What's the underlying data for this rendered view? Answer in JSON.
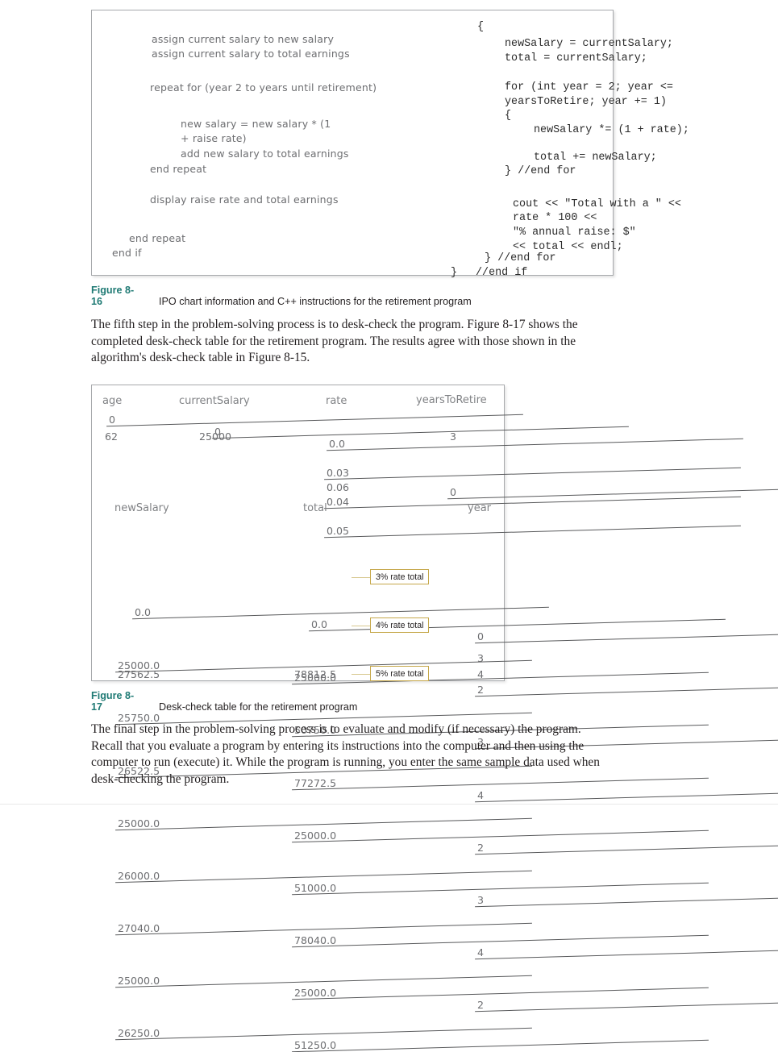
{
  "figure_8_16": {
    "caption_label": "Figure 8-16",
    "caption_text": "IPO chart information and C++ instructions for the retirement program",
    "pseudocode": [
      "assign current salary to new salary",
      "assign current salary to total earnings",
      "repeat for (year 2 to years until retirement)",
      "new salary = new salary * (1",
      "+ raise rate)",
      "add new salary to total earnings",
      "end repeat",
      "display raise rate and total earnings",
      "end repeat",
      "end if"
    ],
    "code": [
      "{",
      "newSalary = currentSalary;",
      "total = currentSalary;",
      "for (int year = 2; year <=",
      "yearsToRetire; year += 1)",
      "{",
      "newSalary *= (1 + rate);",
      "total += newSalary;",
      "} //end for",
      "cout << \"Total with a \" <<",
      "rate * 100 <<",
      "\"% annual raise: $\"",
      "<< total << endl;",
      "} //end for",
      "}",
      "//end if"
    ]
  },
  "paragraph_1": "The fifth step in the problem-solving process is to desk-check the program. Figure 8-17 shows the completed desk-check table for the retirement program. The results agree with those shown in the algorithm's desk-check table in Figure 8-15.",
  "figure_8_17": {
    "caption_label": "Figure 8-17",
    "caption_text": "Desk-check table for the retirement program",
    "top_table": {
      "headers": [
        "age",
        "currentSalary",
        "rate",
        "yearsToRetire"
      ],
      "columns": {
        "age": [
          {
            "value": "0",
            "struck": true
          },
          {
            "value": "62",
            "struck": false
          }
        ],
        "currentSalary": [
          {
            "value": "0",
            "struck": true
          },
          {
            "value": "25000",
            "struck": false
          }
        ],
        "rate": [
          {
            "value": "0.0",
            "struck": true
          },
          {
            "value": "0.03",
            "struck": true
          },
          {
            "value": "0.04",
            "struck": true
          },
          {
            "value": "0.05",
            "struck": true
          },
          {
            "value": "0.06",
            "struck": false
          }
        ],
        "yearsToRetire": [
          {
            "value": "0",
            "struck": true
          },
          {
            "value": "3",
            "struck": false
          }
        ]
      }
    },
    "bottom_table": {
      "headers": [
        "newSalary",
        "total",
        "year"
      ],
      "rows": [
        {
          "newSalary": "0.0",
          "newSalary_struck": true,
          "total": "0.0",
          "total_struck": true,
          "year": "0",
          "year_struck": true,
          "callout": null
        },
        {
          "newSalary": "25000.0",
          "newSalary_struck": true,
          "total": "25000.0",
          "total_struck": true,
          "year": "2",
          "year_struck": true,
          "callout": null
        },
        {
          "newSalary": "25750.0",
          "newSalary_struck": true,
          "total": "50750.0",
          "total_struck": true,
          "year": "3",
          "year_struck": true,
          "callout": null
        },
        {
          "newSalary": "26522.5",
          "newSalary_struck": true,
          "total": "77272.5",
          "total_struck": true,
          "year": "4",
          "year_struck": true,
          "callout": "3% rate total"
        },
        {
          "newSalary": "25000.0",
          "newSalary_struck": true,
          "total": "25000.0",
          "total_struck": true,
          "year": "2",
          "year_struck": true,
          "callout": null
        },
        {
          "newSalary": "26000.0",
          "newSalary_struck": true,
          "total": "51000.0",
          "total_struck": true,
          "year": "3",
          "year_struck": true,
          "callout": null
        },
        {
          "newSalary": "27040.0",
          "newSalary_struck": true,
          "total": "78040.0",
          "total_struck": true,
          "year": "4",
          "year_struck": true,
          "callout": "4% rate total"
        },
        {
          "newSalary": "25000.0",
          "newSalary_struck": true,
          "total": "25000.0",
          "total_struck": true,
          "year": "2",
          "year_struck": true,
          "callout": null
        },
        {
          "newSalary": "26250.0",
          "newSalary_struck": true,
          "total": "51250.0",
          "total_struck": true,
          "year": "3",
          "year_struck": false,
          "callout": null
        },
        {
          "newSalary": "27562.5",
          "newSalary_struck": false,
          "total": "78812.5",
          "total_struck": false,
          "year": "4",
          "year_struck": false,
          "callout": "5% rate total"
        }
      ]
    }
  },
  "paragraph_2": "The final step in the problem-solving process is to evaluate and modify (if necessary) the program. Recall that you evaluate a program by entering its instructions into the computer and then using the computer to run (execute) it. While the program is running, you enter the same sample data used when desk-checking the program.",
  "colors": {
    "caption_label": "#1f7a74",
    "callout_border": "#c6a84b",
    "handwriting": "#6d6e71",
    "box_border": "#a7a9ac"
  }
}
